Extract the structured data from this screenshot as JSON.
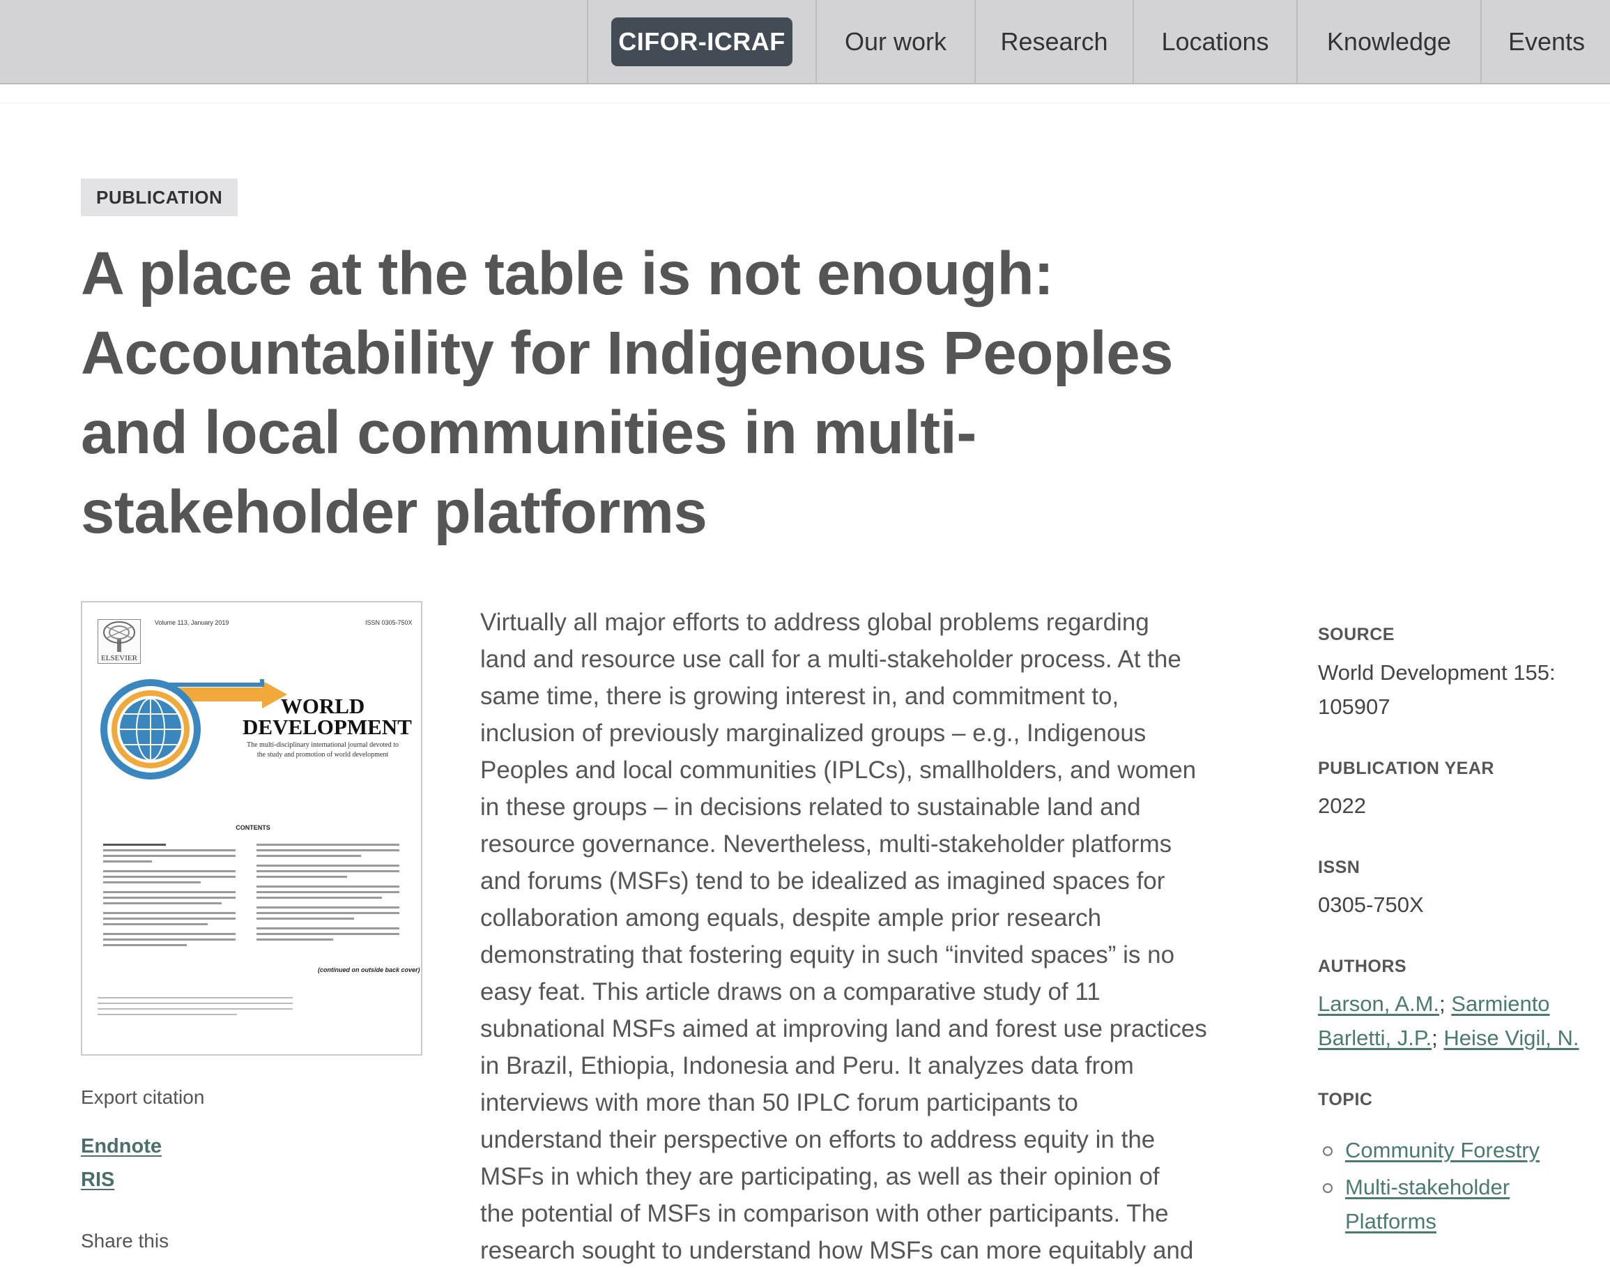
{
  "nav": {
    "brand": "CIFOR-ICRAF",
    "items": [
      "Our work",
      "Research",
      "Locations",
      "Knowledge",
      "Events"
    ]
  },
  "publication": {
    "type_badge": "PUBLICATION",
    "title": "A place at the table is not enough: Accountability for Indigenous Peoples and local communities in multi-stakeholder platforms",
    "abstract_lines": [
      "Virtually all major efforts to address global problems regarding",
      "land and resource use call for a multi-stakeholder process. At the",
      "same time, there is growing interest in, and commitment to,",
      "inclusion of previously marginalized groups – e.g., Indigenous",
      "Peoples and local communities (IPLCs), smallholders, and women",
      "in these groups – in decisions related to sustainable land and",
      "resource governance. Nevertheless, multi-stakeholder platforms",
      "and forums (MSFs) tend to be idealized as imagined spaces for",
      "collaboration among equals, despite ample prior research",
      "demonstrating that fostering equity in such “invited spaces” is no",
      "easy feat. This article draws on a comparative study of 11",
      "subnational MSFs aimed at improving land and forest use practices",
      "in Brazil, Ethiopia, Indonesia and Peru. It analyzes data from",
      "interviews with more than 50 IPLC forum participants to",
      "understand their perspective on efforts to address equity in the",
      "MSFs in which they are participating, as well as their opinion of",
      "the potential of MSFs in comparison with other participants. The",
      "research sought to understand how MSFs can more equitably and"
    ]
  },
  "cover": {
    "volume": "Volume 113, January 2019",
    "issn": "ISSN 0305-750X",
    "publisher": "ELSEVIER",
    "title_line1": "WORLD",
    "title_line2": "DEVELOPMENT",
    "tagline": "The multi-disciplinary international journal devoted to the study and promotion of world development",
    "contents_label": "CONTENTS",
    "continued": "(continued on outside back cover)"
  },
  "export": {
    "label": "Export citation",
    "endnote": "Endnote",
    "ris": "RIS",
    "share": "Share this"
  },
  "meta": {
    "source_label": "SOURCE",
    "source_value": "World Development 155: 105907",
    "year_label": "PUBLICATION YEAR",
    "year_value": "2022",
    "issn_label": "ISSN",
    "issn_value": "0305-750X",
    "authors_label": "AUTHORS",
    "authors": [
      "Larson, A.M.",
      "Sarmiento Barletti, J.P.",
      "Heise Vigil, N."
    ],
    "topic_label": "TOPIC",
    "topics": [
      "Community Forestry",
      "Multi-stakeholder Platforms"
    ]
  },
  "colors": {
    "nav_bg": "#d3d3d5",
    "brand_bg": "#434b55",
    "heading": "#555555",
    "link": "#4a7a72"
  }
}
